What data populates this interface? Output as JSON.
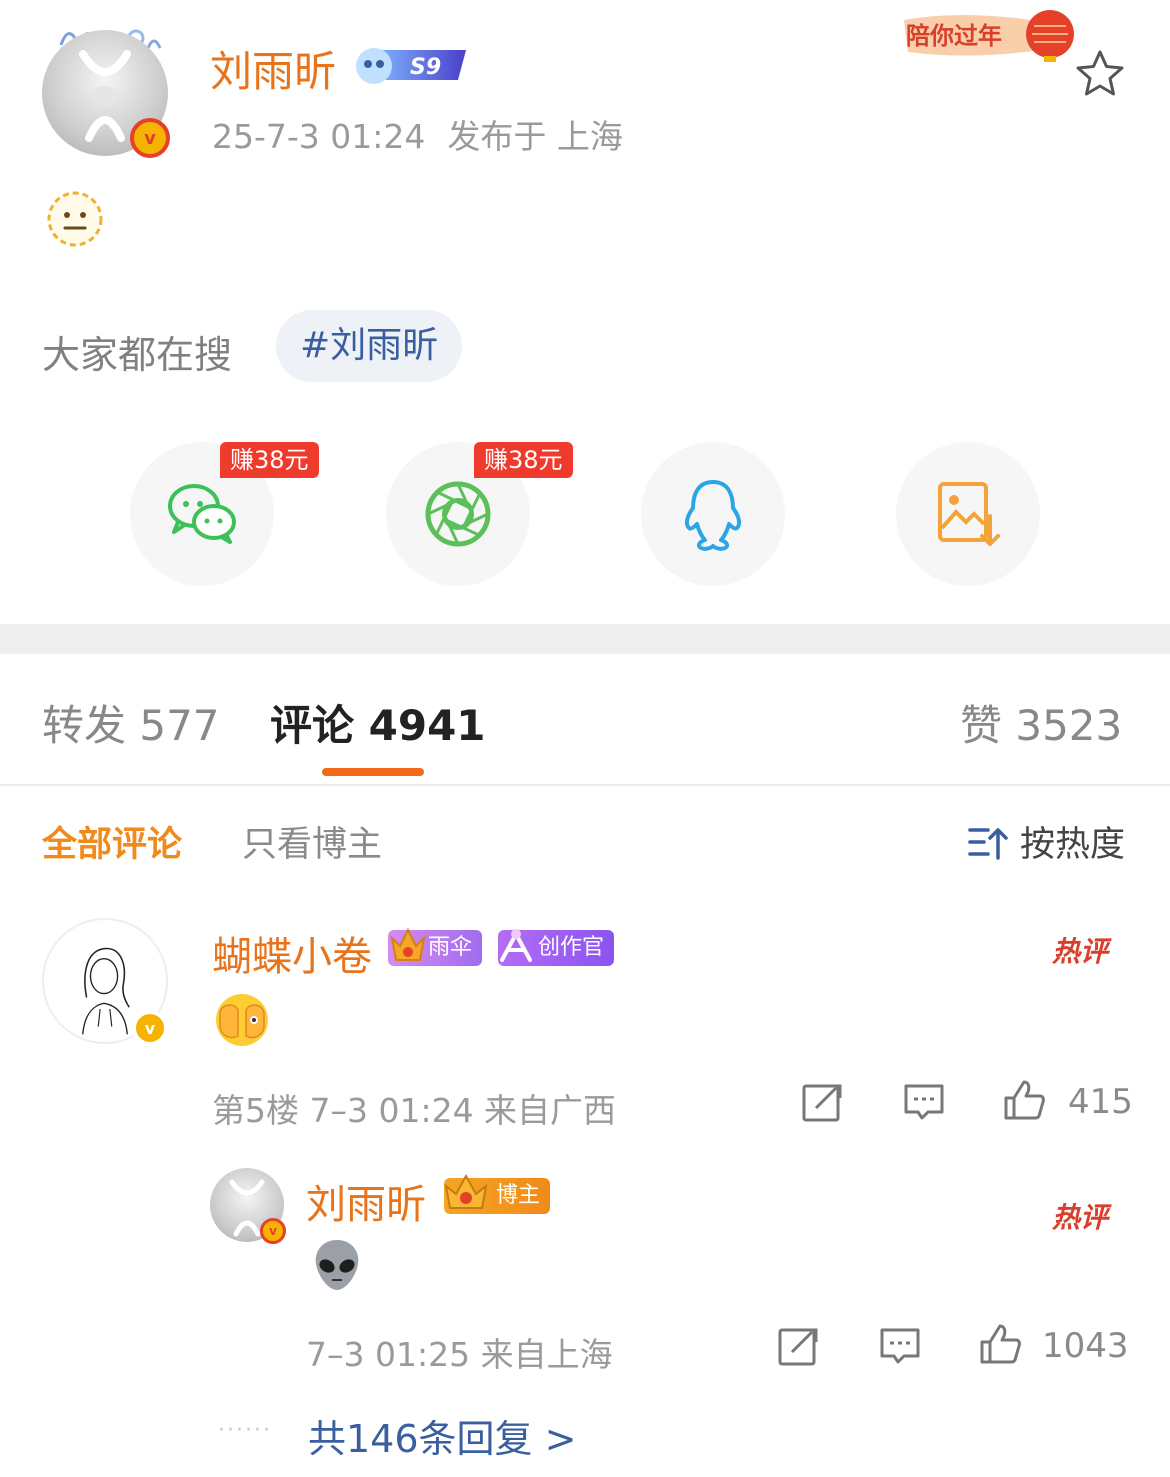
{
  "post": {
    "author": "刘雨昕",
    "level": "S9",
    "time": "25-7-3 01:24",
    "location": "发布于 上海",
    "promo_badge": "陪你过年",
    "content_emoji": "neutral-face-emoji"
  },
  "search": {
    "label": "大家都在搜",
    "tag": "#刘雨昕"
  },
  "share": {
    "earn_label": "赚38元",
    "targets": [
      "wechat-icon",
      "moments-icon",
      "qq-icon",
      "save-image-icon"
    ]
  },
  "tabs": {
    "repost": "转发 577",
    "comments": "评论 4941",
    "likes": "赞 3523"
  },
  "filters": {
    "all": "全部评论",
    "blogger_only": "只看博主",
    "sort": "按热度"
  },
  "comments": [
    {
      "user": "蝴蝶小卷",
      "badge1": "雨伞",
      "badge2": "创作官",
      "hot": "热评",
      "floor_meta": "第5楼  7–3 01:24  来自广西",
      "likes": "415",
      "content_emoji": "face-with-hands-over-eyes-emoji"
    },
    {
      "user": "刘雨昕",
      "badge1": "博主",
      "hot": "热评",
      "meta": "7–3 01:25  来自上海",
      "likes": "1043",
      "content_emoji": "alien-emoji"
    }
  ],
  "replies": {
    "more": "共146条回复 >"
  },
  "colors": {
    "accent_orange": "#e8731a",
    "link_blue": "#3a5fa0",
    "hot_red": "#d8402c"
  }
}
